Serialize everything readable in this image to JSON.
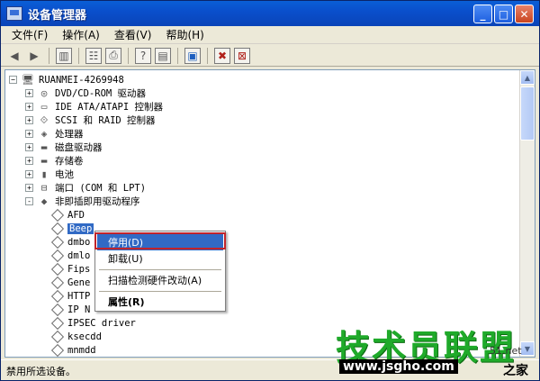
{
  "window": {
    "title": "设备管理器"
  },
  "title_buttons": [
    "_",
    "□",
    "✕"
  ],
  "menubar": [
    {
      "label": "文件(F)"
    },
    {
      "label": "操作(A)"
    },
    {
      "label": "查看(V)"
    },
    {
      "label": "帮助(H)"
    }
  ],
  "toolbar": [
    "back-icon",
    "forward-icon",
    "console-tree-icon",
    "properties-icon",
    "print-icon",
    "help-icon",
    "show-hide-icon",
    "scan-icon",
    "disable-icon",
    "uninstall-icon"
  ],
  "tree": {
    "root": "RUANMEI-4269948",
    "categories": [
      {
        "label": "DVD/CD-ROM 驱动器",
        "expander": "+"
      },
      {
        "label": "IDE ATA/ATAPI 控制器",
        "expander": "+"
      },
      {
        "label": "SCSI 和 RAID 控制器",
        "expander": "+"
      },
      {
        "label": "处理器",
        "expander": "+"
      },
      {
        "label": "磁盘驱动器",
        "expander": "+"
      },
      {
        "label": "存储卷",
        "expander": "+"
      },
      {
        "label": "电池",
        "expander": "+"
      },
      {
        "label": "端口 (COM 和 LPT)",
        "expander": "+"
      },
      {
        "label": "非即插即用驱动程序",
        "expander": "-"
      }
    ],
    "drivers": [
      "AFD",
      "Beep",
      "dmbo",
      "dmlo",
      "Fips",
      "Gene",
      "HTTP",
      "IP N",
      "IPSEC driver",
      "ksecdd",
      "mnmdd"
    ]
  },
  "context_menu": {
    "disable": "停用(D)",
    "uninstall": "卸载(U)",
    "scan": "扫描检测硬件改动(A)",
    "properties": "属性(R)"
  },
  "status": "禁用所选设备。",
  "watermark": {
    "title": "技术员联盟",
    "url": "www.jsgho.com",
    "suffix": "之家",
    "tag": "51.net"
  }
}
